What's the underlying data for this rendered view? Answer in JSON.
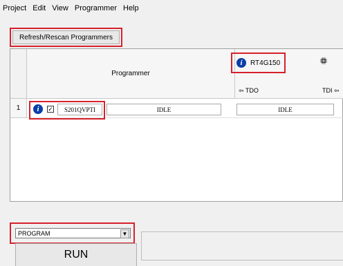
{
  "menu": [
    "Project",
    "Edit",
    "View",
    "Programmer",
    "Help"
  ],
  "toolbar": {
    "refresh_label": "Refresh/Rescan Programmers"
  },
  "grid": {
    "programmer_header": "Programmer",
    "device": {
      "name": "RT4G150",
      "tdo_label": "⇦ TDO",
      "tdi_label": "TDI ⇦"
    },
    "rows": [
      {
        "index": "1",
        "checked": true,
        "programmer_id": "S201QVPTI",
        "status": "IDLE",
        "device_status": "IDLE"
      }
    ]
  },
  "action": {
    "selected": "PROGRAM",
    "options": [
      "PROGRAM"
    ]
  },
  "run_label": "RUN",
  "colors": {
    "highlight": "#d6202a",
    "info_icon": "#0b3fa8"
  }
}
